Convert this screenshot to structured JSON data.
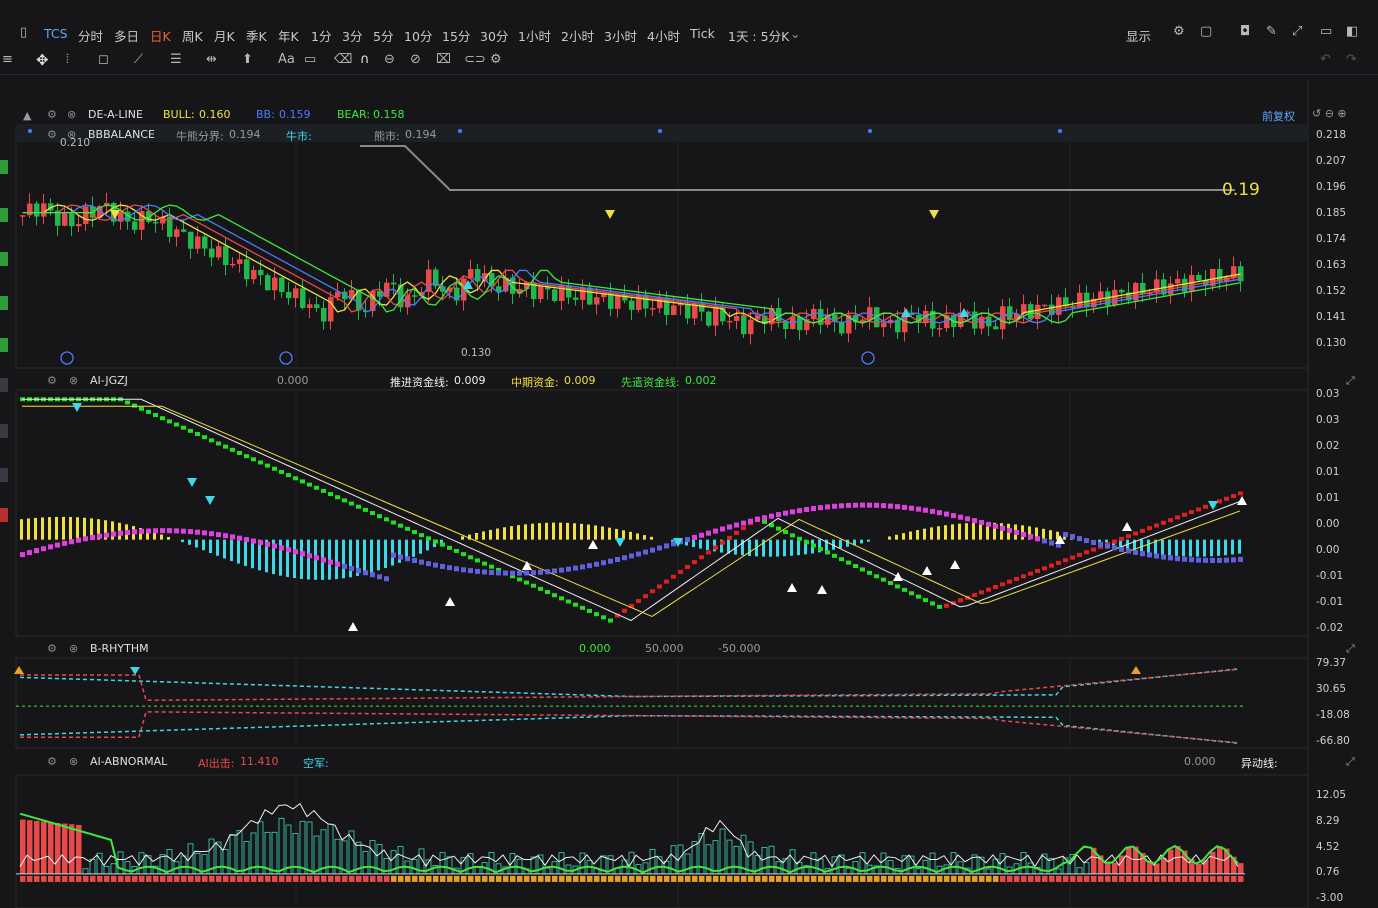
{
  "toolbar": {
    "symbol": "TCS",
    "timeframes": [
      "分时",
      "多日",
      "日K",
      "周K",
      "月K",
      "季K",
      "年K",
      "1分",
      "3分",
      "5分",
      "10分",
      "15分",
      "30分",
      "1小时",
      "2小时",
      "3小时",
      "4小时",
      "Tick"
    ],
    "selected": "日K",
    "range_label": "1天 : 5分K",
    "display_label": "显示"
  },
  "main": {
    "indicator": "DE-A-LINE",
    "bull_label": "BULL:",
    "bull_value": "0.160",
    "bb_label": "BB:",
    "bb_value": "0.159",
    "bear_label": "BEAR:",
    "bear_value": "0.158",
    "balance": "BBBALANCE",
    "bullbear_label": "牛熊分界:",
    "bullbear_value": "0.194",
    "bull_market": "牛市:",
    "bear_market": "熊市:",
    "bear_market_value": "0.194",
    "adjust": "前复权",
    "high_mark": "0.210",
    "low_mark": "0.130",
    "big_value": "0.19",
    "event_icon": "E"
  },
  "jgzj": {
    "name": "AI-JGZJ",
    "blank_value": "0.000",
    "push_label": "推进资金线:",
    "push_value": "0.009",
    "mid_label": "中期资金:",
    "mid_value": "0.009",
    "lead_label": "先遣资金线:",
    "lead_value": "0.002"
  },
  "rhythm": {
    "name": "B-RHYTHM",
    "v1": "0.000",
    "v2": "50.000",
    "v3": "-50.000"
  },
  "abnormal": {
    "name": "AI-ABNORMAL",
    "ai_label": "AI出击:",
    "ai_value": "11.410",
    "empty_label": "空军:",
    "blank_value": "0.000",
    "move_label": "异动线:"
  },
  "colors": {
    "up": "#e84a4a",
    "down": "#20b84a",
    "bg": "#161618",
    "cyan": "#3fd8e8",
    "yellow": "#f0e040",
    "magenta": "#e040e0"
  },
  "chart_data": [
    {
      "type": "candlestick",
      "title": "DE-A-LINE",
      "y_ticks": [
        0.218,
        0.207,
        0.196,
        0.185,
        0.174,
        0.163,
        0.152,
        0.141,
        0.13
      ],
      "ylim": [
        0.128,
        0.22
      ],
      "series": [
        {
          "name": "BULL",
          "values": [
            0.16
          ]
        },
        {
          "name": "BB",
          "values": [
            0.159
          ]
        },
        {
          "name": "BEAR",
          "values": [
            0.158
          ]
        }
      ],
      "annotations": [
        "0.210",
        "0.130",
        "0.19"
      ]
    },
    {
      "type": "bar",
      "title": "AI-JGZJ",
      "y_ticks": [
        0.03,
        0.03,
        0.02,
        0.01,
        0.01,
        0.0,
        -0.0,
        -0.01,
        -0.01,
        -0.02
      ],
      "ylim": [
        -0.021,
        0.034
      ]
    },
    {
      "type": "line",
      "title": "B-RHYTHM",
      "y_ticks": [
        79.37,
        30.65,
        -18.08,
        -66.8
      ],
      "ylim": [
        -75,
        90
      ]
    },
    {
      "type": "bar",
      "title": "AI-ABNORMAL",
      "y_ticks": [
        12.05,
        8.29,
        4.52,
        0.76,
        -3.0
      ],
      "ylim": [
        -3.5,
        14
      ]
    }
  ]
}
